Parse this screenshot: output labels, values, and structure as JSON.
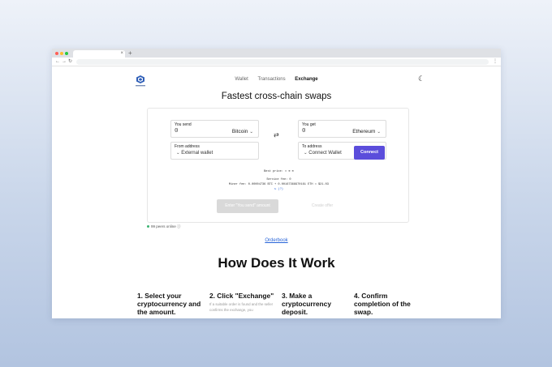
{
  "browser": {
    "new_tab_symbol": "+",
    "tab_close_symbol": "×",
    "back_icon": "←",
    "forward_icon": "→",
    "reload_icon": "↻",
    "menu_icon": "⋮",
    "dot_colors": [
      "#ff5f57",
      "#febc2e",
      "#28c840"
    ]
  },
  "header": {
    "nav": [
      "Wallet",
      "Transactions",
      "Exchange"
    ],
    "active_nav": "Exchange",
    "moon_icon": "☾"
  },
  "title": "Fastest cross-chain swaps",
  "swap": {
    "send": {
      "label": "You send",
      "amount": "0",
      "coin": "Bitcoin"
    },
    "get": {
      "label": "You get",
      "amount": "0",
      "coin": "Ethereum"
    },
    "swap_icon": "⇄",
    "chevron": "⌄",
    "from": {
      "label": "From address",
      "value": "External wallet"
    },
    "to": {
      "label": "To address",
      "value": "Connect Wallet",
      "button": "Connect"
    },
    "best_price": "Best price: ",
    "best_price_icons": "✕ ⊕ ≋",
    "service_fee": "Service fee: 0",
    "miner_fee": "Miner fee: 0.00004736 BTC + 0.00167368970161 ETH ≈ $21.03",
    "refresh_note": "↻ (?)",
    "enter_button": "Enter \"You send\" amount",
    "create_button": "Create offer"
  },
  "status": {
    "peers": "99 peers online",
    "peers_info_icon": "ⓘ"
  },
  "orderbook_link": "Orderbook",
  "how_title": "How Does It Work",
  "steps": [
    {
      "title": "1. Select your cryptocurrency and the amount.",
      "desc": ""
    },
    {
      "title": "2. Click \"Exchange\"",
      "desc": "If a suitable order is found and the seller confirms the exchange, you"
    },
    {
      "title": "3. Make a cryptocurrency deposit.",
      "desc": ""
    },
    {
      "title": "4. Confirm completion of the swap.",
      "desc": ""
    }
  ],
  "colors": {
    "accent": "#5b4ddb",
    "link": "#2864d8",
    "online": "#3cb371"
  }
}
